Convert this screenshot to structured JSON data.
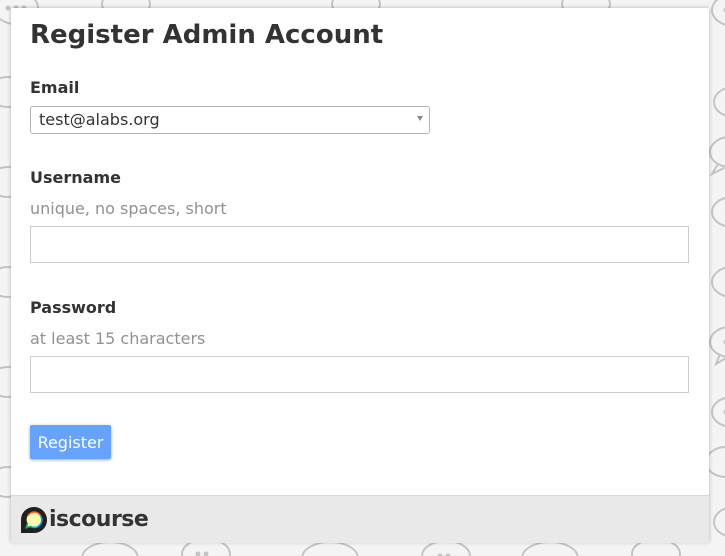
{
  "page": {
    "title": "Register Admin Account"
  },
  "form": {
    "email": {
      "label": "Email",
      "value": "test@alabs.org"
    },
    "username": {
      "label": "Username",
      "hint": "unique, no spaces, short",
      "value": ""
    },
    "password": {
      "label": "Password",
      "hint": "at least 15 characters",
      "value": ""
    },
    "submit_label": "Register"
  },
  "footer": {
    "brand": "iscourse",
    "logo_icon": "discourse-logo-icon"
  },
  "colors": {
    "accent": "#66a3ff",
    "text": "#333333",
    "hint": "#919191",
    "footer_bg": "#e9e9e9",
    "logo_yellow": "#fff9ae",
    "logo_blue": "#00aeef",
    "logo_green": "#00a94f",
    "logo_red": "#f15d22"
  }
}
